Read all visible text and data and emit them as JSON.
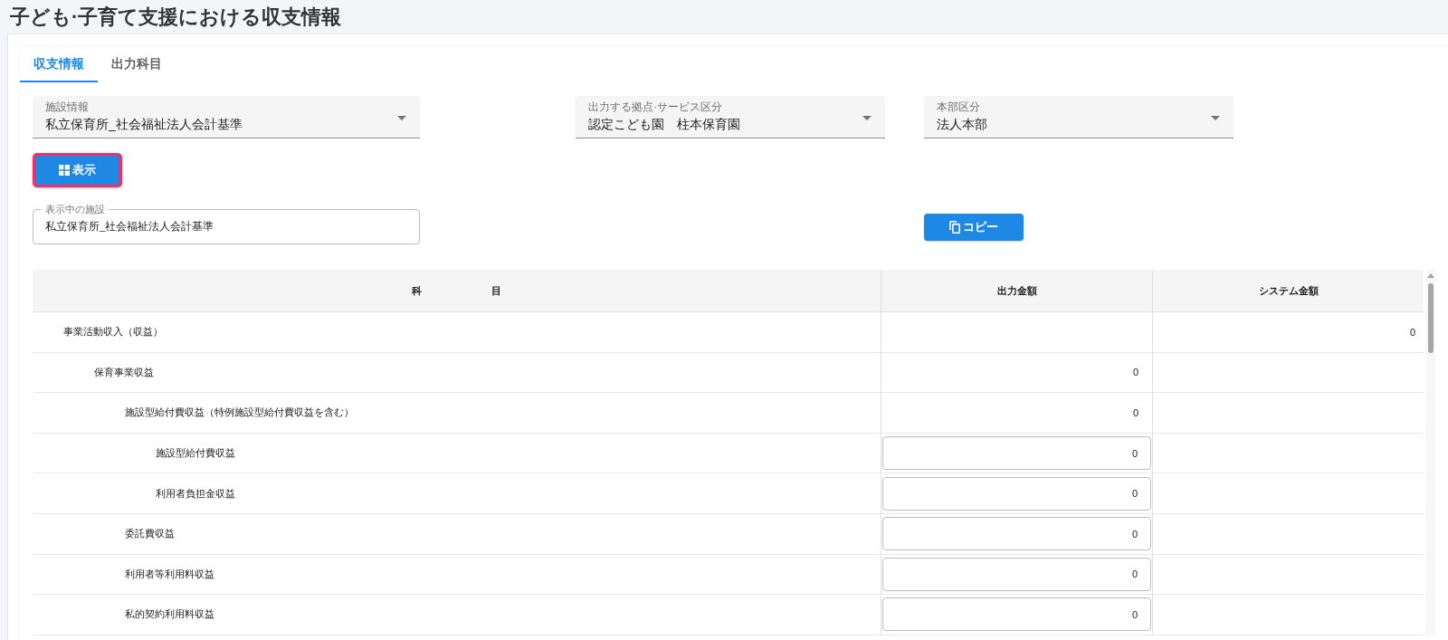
{
  "page": {
    "title": "子ども·子育て支援における収支情報"
  },
  "tabs": [
    {
      "label": "収支情報",
      "selected": true
    },
    {
      "label": "出力科目",
      "selected": false
    }
  ],
  "filters": [
    {
      "label": "施設情報",
      "value": "私立保育所_社会福祉法人会計基準"
    },
    {
      "label": "出力する拠点·サービス区分",
      "value": "認定こども園　柱本保育園"
    },
    {
      "label": "本部区分",
      "value": "法人本部"
    }
  ],
  "show_button": {
    "label": "表示",
    "focused": true
  },
  "current_facility": {
    "label": "表示中の施設",
    "value": "私立保育所_社会福祉法人会計基準"
  },
  "copy_button": {
    "label": "コピー"
  },
  "table": {
    "columns": [
      "科　　　　　　　目",
      "出力金額",
      "システム金額"
    ],
    "rows": [
      {
        "label": "事業活動収入（収益）",
        "output_editable": false,
        "system_amount": "0",
        "children": [
          {
            "label": "保育事業収益",
            "output_editable": false,
            "output_amount": "0",
            "children": [
              {
                "label": "施設型給付費収益（特例施設型給付費収益を含む）",
                "output_editable": false,
                "output_amount": "0",
                "children": [
                  {
                    "label": "施設型給付費収益",
                    "output_editable": true,
                    "output_amount": "0"
                  },
                  {
                    "label": "利用者負担金収益",
                    "output_editable": true,
                    "output_amount": "0"
                  }
                ]
              },
              {
                "label": "委託費収益",
                "output_editable": true,
                "output_amount": "0"
              },
              {
                "label": "利用者等利用料収益",
                "output_editable": true,
                "output_amount": "0"
              },
              {
                "label": "私的契約利用料収益",
                "output_editable": true,
                "output_amount": "0"
              }
            ]
          }
        ]
      }
    ]
  }
}
